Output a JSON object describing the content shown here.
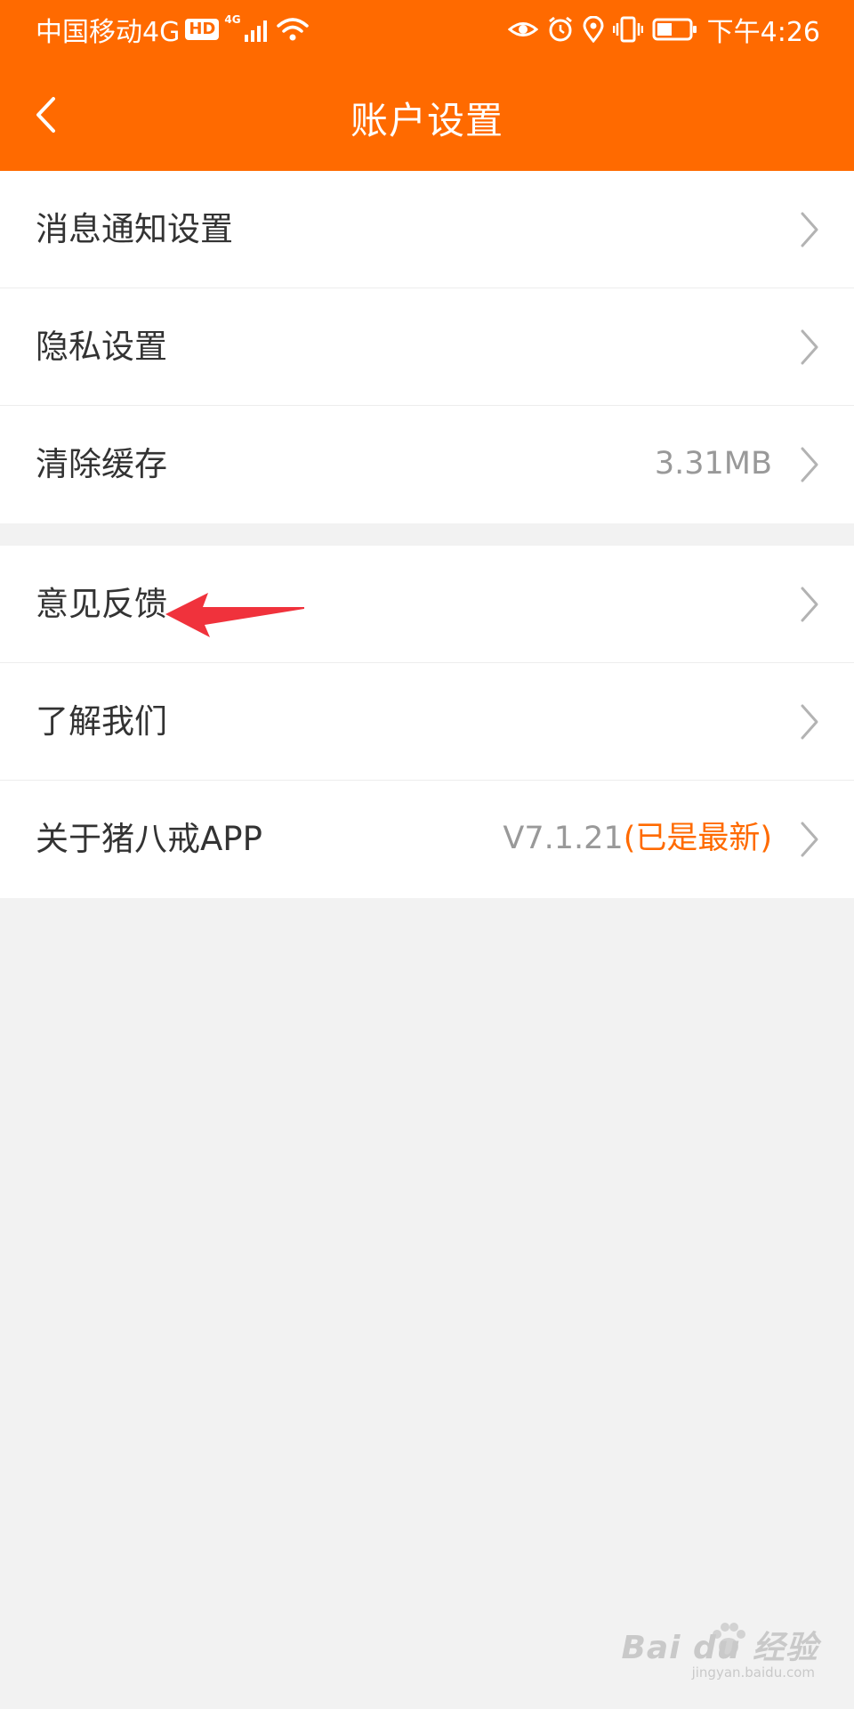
{
  "status_bar": {
    "carrier": "中国移动4G",
    "hd_badge": "HD",
    "signal_label": "4G",
    "time": "下午4:26"
  },
  "header": {
    "title": "账户设置",
    "back_icon": "chevron-left-icon"
  },
  "settings": {
    "group1": [
      {
        "label": "消息通知设置",
        "value": ""
      },
      {
        "label": "隐私设置",
        "value": ""
      },
      {
        "label": "清除缓存",
        "value": "3.31MB"
      }
    ],
    "group2": [
      {
        "label": "意见反馈",
        "value": ""
      },
      {
        "label": "了解我们",
        "value": ""
      },
      {
        "label": "关于猪八戒APP",
        "value": "V7.1.21",
        "value_highlight": "(已是最新)"
      }
    ]
  },
  "watermark": {
    "main": "Bai du 经验",
    "sub": "jingyan.baidu.com"
  },
  "colors": {
    "brand": "#ff6a00",
    "background": "#f2f2f2",
    "annotation_arrow": "#f0323c"
  }
}
